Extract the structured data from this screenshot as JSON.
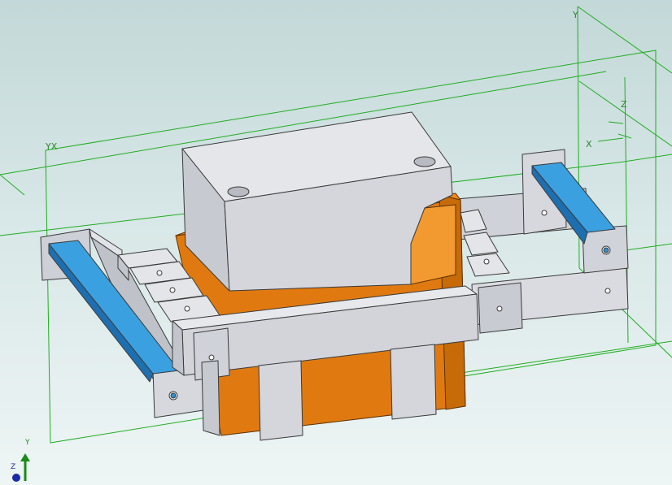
{
  "viewport": {
    "plane_labels": {
      "front": "YX",
      "side_top": "Y",
      "side_mid": "Z",
      "side_x": "X"
    },
    "triad": {
      "y": "Y",
      "z": "Z"
    }
  },
  "colors": {
    "background_top": "#c3d8d8",
    "background_bottom": "#eef5f5",
    "construction_plane": "#1fae1f",
    "body_gray": "#d6d8de",
    "body_orange": "#e07a10",
    "rail_blue": "#2d8fd0",
    "edge": "#3a3a3a"
  },
  "model": {
    "parts": [
      "top-block",
      "orange-housing",
      "left-bracket",
      "right-bracket",
      "front-band",
      "bottom-straps",
      "terminal-tabs",
      "blue-rail-left",
      "blue-rail-right"
    ]
  }
}
